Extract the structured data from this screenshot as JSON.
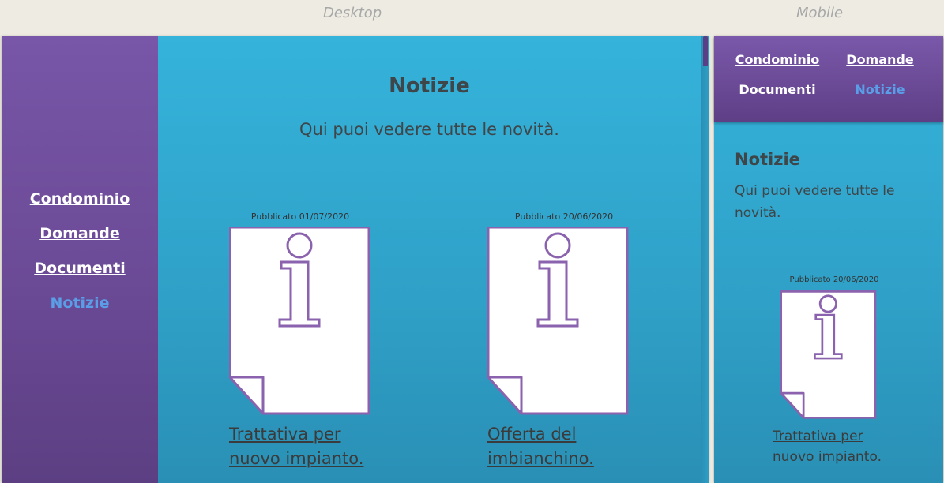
{
  "labels": {
    "desktop": "Desktop",
    "mobile": "Mobile"
  },
  "nav": {
    "condominio": "Condominio",
    "domande": "Domande",
    "documenti": "Documenti",
    "notizie": "Notizie"
  },
  "page": {
    "title": "Notizie",
    "subtitle": "Qui puoi vedere tutte le novità."
  },
  "news": [
    {
      "date": "Pubblicato 01/07/2020",
      "title_line1": "Trattativa per",
      "title_line2": "nuovo impianto."
    },
    {
      "date": "Pubblicato 20/06/2020",
      "title_line1": "Offerta del",
      "title_line2": "imbianchino."
    }
  ],
  "mobile_news": {
    "date": "Pubblicato 20/06/2020",
    "title_line1": "Trattativa per",
    "title_line2": "nuovo impianto."
  },
  "colors": {
    "sidebar": "#6b4a96",
    "content": "#32a9d2",
    "active_link": "#5a9ee8",
    "icon_stroke": "#8a62ad"
  },
  "icons": {
    "news": "info-document-icon"
  }
}
